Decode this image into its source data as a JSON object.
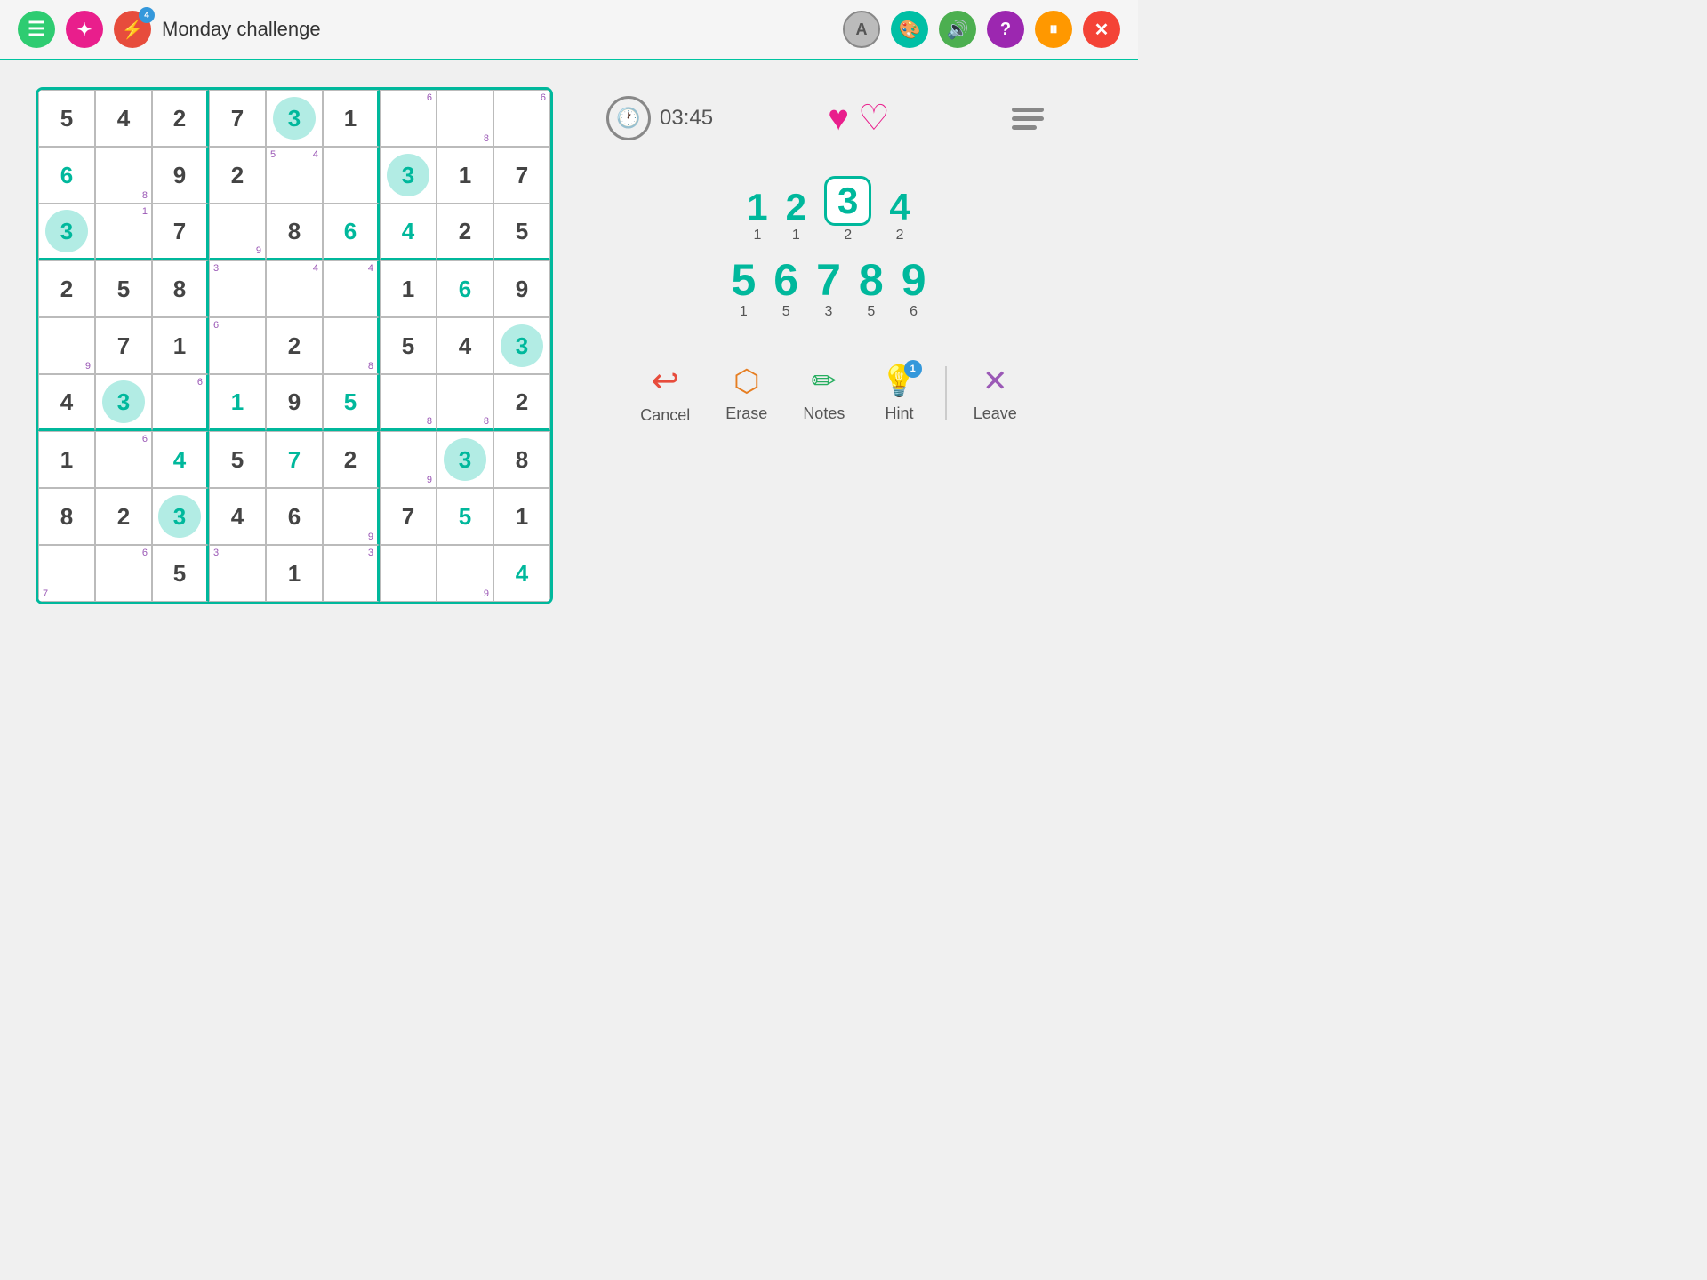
{
  "header": {
    "title": "Monday challenge",
    "menu_icon": "☰",
    "badge_icon": "!",
    "flash_icon": "⚡",
    "flash_badge": "4",
    "theme_icon": "A",
    "palette_icon": "🎨",
    "sound_icon": "🔊",
    "help_icon": "?",
    "pause_icon": "⏸",
    "close_icon": "✕"
  },
  "timer": {
    "display": "03:45",
    "icon": "🕐"
  },
  "hearts": {
    "filled": 1,
    "empty": 1
  },
  "numbers": [
    {
      "digit": "1",
      "count": "1",
      "selected": false
    },
    {
      "digit": "2",
      "count": "1",
      "selected": false
    },
    {
      "digit": "3",
      "count": "2",
      "selected": true
    },
    {
      "digit": "4",
      "count": "2",
      "selected": false
    },
    {
      "digit": "5",
      "count": "1",
      "selected": false
    },
    {
      "digit": "6",
      "count": "5",
      "selected": false
    },
    {
      "digit": "7",
      "count": "3",
      "selected": false
    },
    {
      "digit": "8",
      "count": "5",
      "selected": false
    },
    {
      "digit": "9",
      "count": "6",
      "selected": false
    }
  ],
  "actions": {
    "cancel": "Cancel",
    "erase": "Erase",
    "notes": "Notes",
    "hint": "Hint",
    "hint_badge": "1",
    "leave": "Leave"
  },
  "grid": {
    "cells": [
      {
        "r": 0,
        "c": 0,
        "val": "5",
        "type": "given"
      },
      {
        "r": 0,
        "c": 1,
        "val": "4",
        "type": "given"
      },
      {
        "r": 0,
        "c": 2,
        "val": "2",
        "type": "given"
      },
      {
        "r": 0,
        "c": 3,
        "val": "7",
        "type": "given"
      },
      {
        "r": 0,
        "c": 4,
        "val": "3",
        "type": "selected"
      },
      {
        "r": 0,
        "c": 5,
        "val": "1",
        "type": "given"
      },
      {
        "r": 0,
        "c": 6,
        "val": "",
        "type": "empty",
        "note_tr": "6"
      },
      {
        "r": 0,
        "c": 7,
        "val": "",
        "type": "empty",
        "note_br": "8"
      },
      {
        "r": 0,
        "c": 8,
        "val": "",
        "type": "empty",
        "note_tr": "6"
      },
      {
        "r": 1,
        "c": 0,
        "val": "6",
        "type": "user-teal"
      },
      {
        "r": 1,
        "c": 1,
        "val": "",
        "type": "empty",
        "note_br": "8"
      },
      {
        "r": 1,
        "c": 2,
        "val": "9",
        "type": "given"
      },
      {
        "r": 1,
        "c": 3,
        "val": "2",
        "type": "given"
      },
      {
        "r": 1,
        "c": 4,
        "val": "",
        "type": "empty",
        "note_tl": "5",
        "note_tr": "4"
      },
      {
        "r": 1,
        "c": 5,
        "val": "",
        "type": "empty"
      },
      {
        "r": 1,
        "c": 6,
        "val": "3",
        "type": "selected"
      },
      {
        "r": 1,
        "c": 7,
        "val": "1",
        "type": "given"
      },
      {
        "r": 1,
        "c": 8,
        "val": "7",
        "type": "given"
      },
      {
        "r": 2,
        "c": 0,
        "val": "3",
        "type": "selected"
      },
      {
        "r": 2,
        "c": 1,
        "val": "",
        "type": "empty",
        "note_tr": "1"
      },
      {
        "r": 2,
        "c": 2,
        "val": "7",
        "type": "given"
      },
      {
        "r": 2,
        "c": 3,
        "val": "",
        "type": "empty",
        "note_br": "9"
      },
      {
        "r": 2,
        "c": 4,
        "val": "8",
        "type": "given"
      },
      {
        "r": 2,
        "c": 5,
        "val": "6",
        "type": "user-teal"
      },
      {
        "r": 2,
        "c": 6,
        "val": "4",
        "type": "user-teal"
      },
      {
        "r": 2,
        "c": 7,
        "val": "2",
        "type": "given"
      },
      {
        "r": 2,
        "c": 8,
        "val": "5",
        "type": "given"
      },
      {
        "r": 3,
        "c": 0,
        "val": "2",
        "type": "given"
      },
      {
        "r": 3,
        "c": 1,
        "val": "5",
        "type": "given"
      },
      {
        "r": 3,
        "c": 2,
        "val": "8",
        "type": "given"
      },
      {
        "r": 3,
        "c": 3,
        "val": "",
        "type": "empty",
        "note_tl": "3"
      },
      {
        "r": 3,
        "c": 4,
        "val": "",
        "type": "empty",
        "note_tr": "4"
      },
      {
        "r": 3,
        "c": 5,
        "val": "",
        "type": "empty",
        "note_tr": "4"
      },
      {
        "r": 3,
        "c": 6,
        "val": "1",
        "type": "given"
      },
      {
        "r": 3,
        "c": 7,
        "val": "6",
        "type": "user-teal"
      },
      {
        "r": 3,
        "c": 8,
        "val": "9",
        "type": "given"
      },
      {
        "r": 4,
        "c": 0,
        "val": "",
        "type": "empty",
        "note_br": "9"
      },
      {
        "r": 4,
        "c": 1,
        "val": "7",
        "type": "given"
      },
      {
        "r": 4,
        "c": 2,
        "val": "1",
        "type": "given"
      },
      {
        "r": 4,
        "c": 3,
        "val": "",
        "type": "empty",
        "note_tl": "6"
      },
      {
        "r": 4,
        "c": 4,
        "val": "2",
        "type": "given"
      },
      {
        "r": 4,
        "c": 5,
        "val": "",
        "type": "empty",
        "note_br": "8"
      },
      {
        "r": 4,
        "c": 6,
        "val": "5",
        "type": "given"
      },
      {
        "r": 4,
        "c": 7,
        "val": "4",
        "type": "given"
      },
      {
        "r": 4,
        "c": 8,
        "val": "3",
        "type": "selected"
      },
      {
        "r": 5,
        "c": 0,
        "val": "4",
        "type": "given"
      },
      {
        "r": 5,
        "c": 1,
        "val": "3",
        "type": "selected"
      },
      {
        "r": 5,
        "c": 2,
        "val": "",
        "type": "empty",
        "note_tr": "6"
      },
      {
        "r": 5,
        "c": 3,
        "val": "1",
        "type": "user-teal"
      },
      {
        "r": 5,
        "c": 4,
        "val": "9",
        "type": "given"
      },
      {
        "r": 5,
        "c": 5,
        "val": "5",
        "type": "user-teal"
      },
      {
        "r": 5,
        "c": 6,
        "val": "",
        "type": "empty",
        "note_br": "8"
      },
      {
        "r": 5,
        "c": 7,
        "val": "",
        "type": "empty",
        "note_br": "8"
      },
      {
        "r": 5,
        "c": 8,
        "val": "2",
        "type": "given"
      },
      {
        "r": 6,
        "c": 0,
        "val": "1",
        "type": "given"
      },
      {
        "r": 6,
        "c": 1,
        "val": "",
        "type": "empty",
        "note_tr": "6"
      },
      {
        "r": 6,
        "c": 2,
        "val": "4",
        "type": "user-teal"
      },
      {
        "r": 6,
        "c": 3,
        "val": "5",
        "type": "given"
      },
      {
        "r": 6,
        "c": 4,
        "val": "7",
        "type": "user-teal"
      },
      {
        "r": 6,
        "c": 5,
        "val": "2",
        "type": "given"
      },
      {
        "r": 6,
        "c": 6,
        "val": "",
        "type": "empty",
        "note_br": "9"
      },
      {
        "r": 6,
        "c": 7,
        "val": "3",
        "type": "selected"
      },
      {
        "r": 6,
        "c": 8,
        "val": "8",
        "type": "given"
      },
      {
        "r": 7,
        "c": 0,
        "val": "8",
        "type": "given"
      },
      {
        "r": 7,
        "c": 1,
        "val": "2",
        "type": "given"
      },
      {
        "r": 7,
        "c": 2,
        "val": "3",
        "type": "selected"
      },
      {
        "r": 7,
        "c": 3,
        "val": "4",
        "type": "given"
      },
      {
        "r": 7,
        "c": 4,
        "val": "6",
        "type": "given"
      },
      {
        "r": 7,
        "c": 5,
        "val": "",
        "type": "empty",
        "note_br": "9"
      },
      {
        "r": 7,
        "c": 6,
        "val": "7",
        "type": "given"
      },
      {
        "r": 7,
        "c": 7,
        "val": "5",
        "type": "user-teal"
      },
      {
        "r": 7,
        "c": 8,
        "val": "1",
        "type": "given"
      },
      {
        "r": 8,
        "c": 0,
        "val": "",
        "type": "empty",
        "note_bl": "7"
      },
      {
        "r": 8,
        "c": 1,
        "val": "",
        "type": "empty",
        "note_tr": "6"
      },
      {
        "r": 8,
        "c": 2,
        "val": "5",
        "type": "given"
      },
      {
        "r": 8,
        "c": 3,
        "val": "",
        "type": "empty",
        "note_tl": "3"
      },
      {
        "r": 8,
        "c": 4,
        "val": "1",
        "type": "given"
      },
      {
        "r": 8,
        "c": 5,
        "val": "",
        "type": "empty",
        "note_tr": "3"
      },
      {
        "r": 8,
        "c": 6,
        "val": "",
        "type": "empty"
      },
      {
        "r": 8,
        "c": 7,
        "val": "",
        "type": "empty",
        "note_br": "9"
      },
      {
        "r": 8,
        "c": 8,
        "val": "4",
        "type": "user-teal"
      }
    ]
  }
}
